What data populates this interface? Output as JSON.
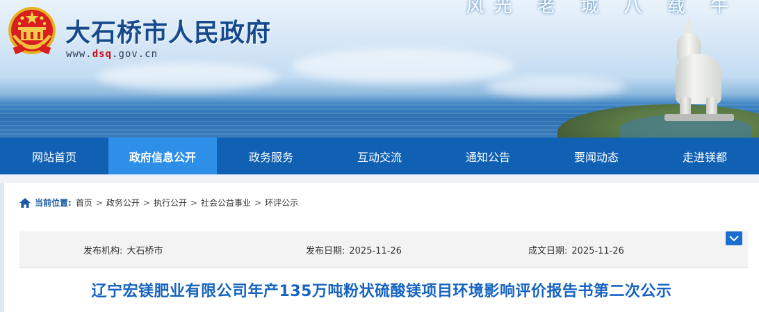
{
  "header": {
    "site_title": "大石桥市人民政府",
    "url_prefix": "www.",
    "url_highlight": "dsq",
    "url_suffix": ".gov.cn",
    "banner_slogan": "风光  老  城  八  载  牛"
  },
  "nav": {
    "items": [
      {
        "label": "网站首页",
        "active": false
      },
      {
        "label": "政府信息公开",
        "active": true
      },
      {
        "label": "政务服务",
        "active": false
      },
      {
        "label": "互动交流",
        "active": false
      },
      {
        "label": "通知公告",
        "active": false
      },
      {
        "label": "要闻动态",
        "active": false
      },
      {
        "label": "走进镁都",
        "active": false
      }
    ]
  },
  "breadcrumb": {
    "label": "当前位置:",
    "items": [
      "首页",
      "政务公开",
      "执行公开",
      "社会公益事业",
      "环评公示"
    ]
  },
  "meta": {
    "publisher_label": "发布机构:",
    "publisher_value": "大石桥市",
    "publish_date_label": "发布日期:",
    "publish_date_value": "2025-11-26",
    "doc_date_label": "成文日期:",
    "doc_date_value": "2025-11-26"
  },
  "article": {
    "title": "辽宁宏镁肥业有限公司年产135万吨粉状硫酸镁项目环境影响评价报告书第二次公示"
  },
  "colors": {
    "nav_bg": "#1060b4",
    "nav_active": "#2e8fe8",
    "title_blue": "#1664c0",
    "site_title": "#164a8c",
    "url_red": "#c8101b"
  },
  "icons": [
    "national-emblem-icon",
    "home-icon",
    "chevron-down-icon"
  ]
}
